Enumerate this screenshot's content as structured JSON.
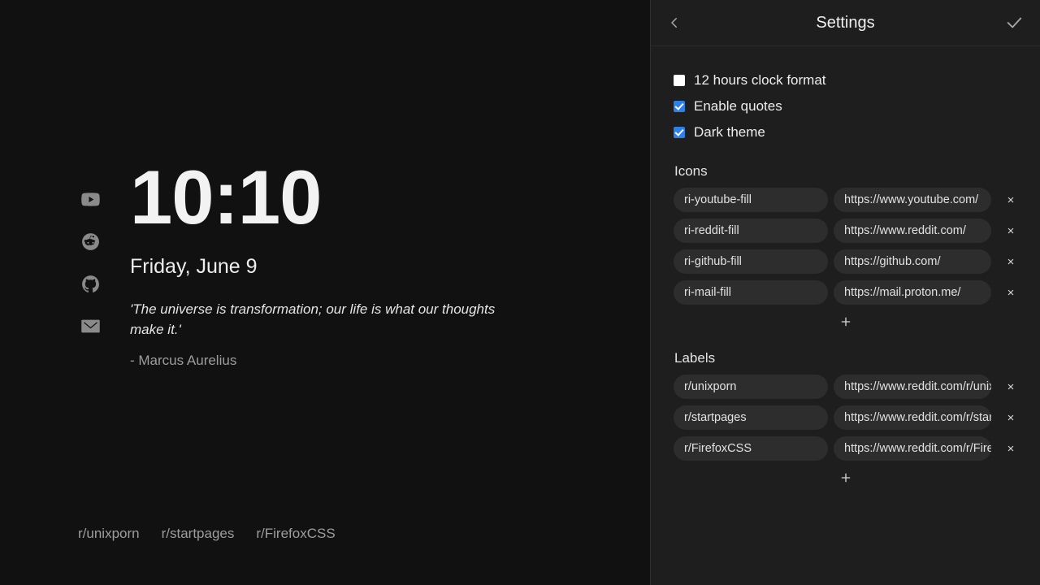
{
  "startpage": {
    "clock": "10:10",
    "date": "Friday, June 9",
    "quote": "'The universe is transformation; our life is what our thoughts make it.'",
    "quote_author": "- Marcus Aurelius",
    "social_icons": [
      {
        "name": "youtube-icon"
      },
      {
        "name": "reddit-icon"
      },
      {
        "name": "github-icon"
      },
      {
        "name": "mail-icon"
      }
    ],
    "footer_links": [
      {
        "label": "r/unixporn"
      },
      {
        "label": "r/startpages"
      },
      {
        "label": "r/FirefoxCSS"
      }
    ]
  },
  "settings": {
    "title": "Settings",
    "back_icon": "chevron-left-icon",
    "done_icon": "check-icon",
    "checkboxes": [
      {
        "label": "12 hours clock format",
        "checked": false
      },
      {
        "label": "Enable quotes",
        "checked": true
      },
      {
        "label": "Dark theme",
        "checked": true
      }
    ],
    "icons_section": {
      "title": "Icons",
      "add_label": "+",
      "remove_label": "×",
      "rows": [
        {
          "name": "ri-youtube-fill",
          "url": "https://www.youtube.com/"
        },
        {
          "name": "ri-reddit-fill",
          "url": "https://www.reddit.com/"
        },
        {
          "name": "ri-github-fill",
          "url": "https://github.com/"
        },
        {
          "name": "ri-mail-fill",
          "url": "https://mail.proton.me/"
        }
      ]
    },
    "labels_section": {
      "title": "Labels",
      "add_label": "+",
      "remove_label": "×",
      "rows": [
        {
          "name": "r/unixporn",
          "url": "https://www.reddit.com/r/unixporn/"
        },
        {
          "name": "r/startpages",
          "url": "https://www.reddit.com/r/startpages/"
        },
        {
          "name": "r/FirefoxCSS",
          "url": "https://www.reddit.com/r/FirefoxCSS/"
        }
      ]
    }
  },
  "colors": {
    "startpage_bg": "#111111",
    "settings_bg": "#1e1e1e",
    "pill_bg": "#2d2d2d",
    "accent_checkbox": "#2f7fe8",
    "text_primary": "#ededed",
    "text_muted": "#9d9d9d"
  }
}
